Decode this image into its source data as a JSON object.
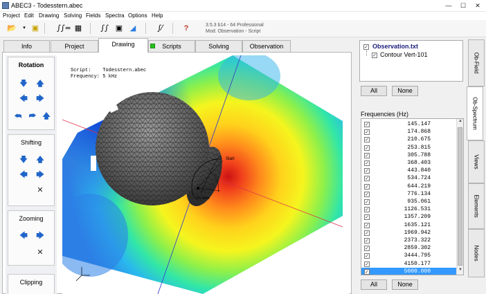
{
  "window": {
    "title": "ABEC3 - Todesstern.abec",
    "minimize": "—",
    "maximize": "☐",
    "close": "✕"
  },
  "menu": [
    "Project",
    "Edit",
    "Drawing",
    "Solving",
    "Fields",
    "Spectra",
    "Options",
    "Help"
  ],
  "version": {
    "line1": "3.5.3 b14 - 64 Professional",
    "line2": "Mod:  Observation - Script"
  },
  "tabs": [
    "Info",
    "Project",
    "Drawing",
    "Scripts",
    "Solving",
    "Observation"
  ],
  "active_tab": "Drawing",
  "controls": {
    "rotation": "Rotation",
    "shifting": "Shifting",
    "zooming": "Zooming",
    "clipping": "Clipping"
  },
  "viewport": {
    "script_label": "Script:",
    "script_value": "Todesstern.abec",
    "freq_label": "Frequency:",
    "freq_value": "5 kHz",
    "start_label": "Start",
    "onaxis_label": "On-axis"
  },
  "observation": {
    "file": "Observation.txt",
    "item": "Contour Vert-101",
    "all": "All",
    "none": "None"
  },
  "frequencies": {
    "title": "Frequencies  (Hz)",
    "values": [
      "145.147",
      "174.868",
      "210.675",
      "253.815",
      "305.788",
      "368.403",
      "443.840",
      "534.724",
      "644.219",
      "776.134",
      "935.061",
      "1126.531",
      "1357.209",
      "1635.121",
      "1969.942",
      "2373.322",
      "2859.302",
      "3444.795",
      "4150.177",
      "5000.000"
    ],
    "selected_index": 19,
    "all": "All",
    "none": "None"
  },
  "side_tabs": [
    "Ob-Field",
    "Ob-Spectrum",
    "Views",
    "Elements",
    "Nodes"
  ],
  "active_side_tab": "Ob-Spectrum"
}
